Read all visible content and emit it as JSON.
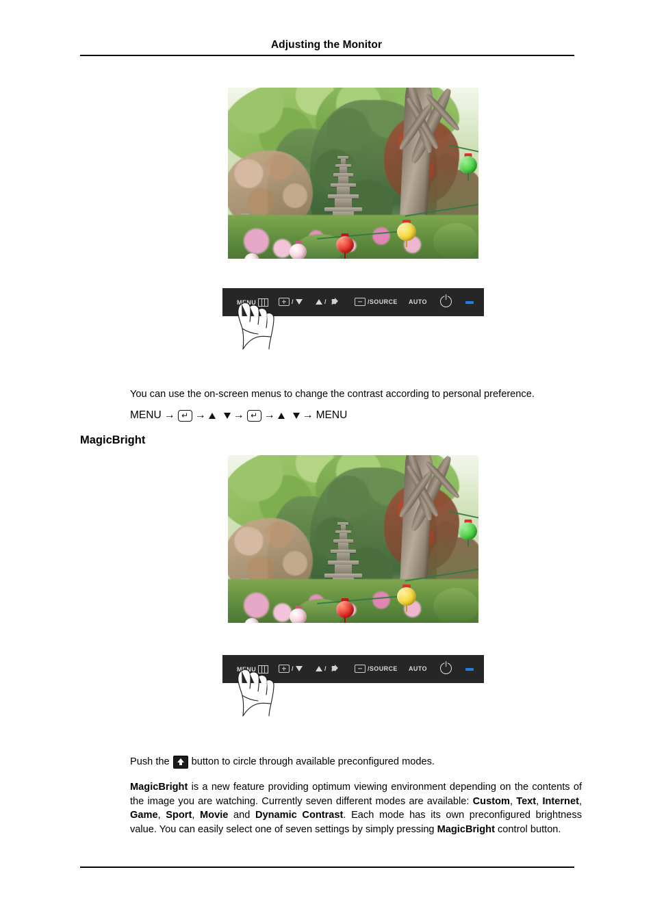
{
  "page": {
    "header_title": "Adjusting the Monitor"
  },
  "contrast_section": {
    "photo_caption": "garden-scene-photo",
    "description": "You can use the on-screen menus to change the contrast according to personal preference.",
    "nav_sequence": {
      "start_label": "MENU",
      "enter_icon": "enter-key-icon",
      "up_icon": "up-triangle-icon",
      "down_icon": "down-triangle-icon",
      "arrow": "→",
      "end_label": "MENU",
      "full_text": "MENU → [enter] → ▲ ▼ → [enter] → ▲ ▼ → MENU"
    }
  },
  "magicbright_section": {
    "heading": "MagicBright",
    "push_line_prefix": "Push the",
    "push_line_suffix": "button to circle through available preconfigured modes.",
    "description_part1": "MagicBright",
    "description_part2": " is a new feature providing optimum viewing environment depending on the contents of the image you are watching. Currently seven different modes are available: ",
    "modes": [
      "Custom",
      "Text",
      "Internet",
      "Game",
      "Sport",
      "Movie",
      "Dynamic Contrast"
    ],
    "modes_separator": ", ",
    "modes_conjunction": " and ",
    "description_part3": ". Each mode has its own preconfigured brightness value. You can easily select one of seven settings by simply pressing ",
    "description_part4": "MagicBright",
    "description_part5": " control button."
  },
  "control_panel": {
    "buttons": [
      {
        "label": "MENU",
        "icon": "menu-grid-icon",
        "name": "menu-button"
      },
      {
        "label": "/",
        "icon": "brightness-box-icon",
        "secondary_icon": "down-triangle-icon",
        "name": "brightness-down-button"
      },
      {
        "label": "/",
        "icon": "up-triangle-icon",
        "secondary_icon": "speaker-volume-icon",
        "name": "volume-up-button"
      },
      {
        "label": "/SOURCE",
        "icon": "enter-box-icon",
        "name": "source-button"
      },
      {
        "label": "AUTO",
        "icon": null,
        "name": "auto-button"
      },
      {
        "label": "",
        "icon": "power-icon",
        "name": "power-button"
      },
      {
        "label": "",
        "icon": "led-indicator",
        "name": "power-led"
      }
    ],
    "hand_icon": "pointing-hand-illustration",
    "background_color": "#262626",
    "led_color": "#1f7fe0",
    "text_color": "#d9d9d9"
  },
  "photo": {
    "alt": "Korean temple garden with stone pagodas and colored paper lanterns",
    "lanterns": [
      {
        "color": "#3fca3a",
        "name": "green-lantern"
      },
      {
        "color": "#f2d32e",
        "name": "yellow-lantern"
      },
      {
        "color": "#e02a23",
        "name": "red-lantern"
      },
      {
        "color": "#f7c8d8",
        "name": "pink-lantern"
      }
    ]
  }
}
